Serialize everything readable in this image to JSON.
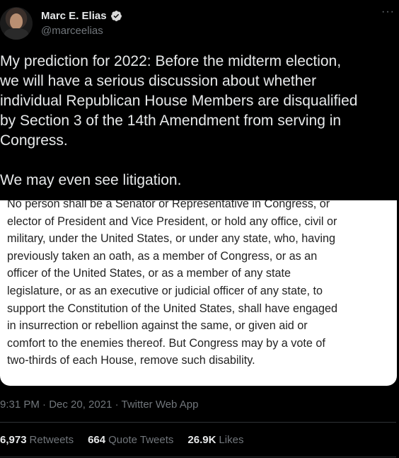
{
  "author": {
    "display_name": "Marc E. Elias",
    "handle": "@marceelias",
    "verified": true,
    "avatar_icon": "profile-photo",
    "more_icon": "more-options-icon"
  },
  "tweet": {
    "text": "My prediction for 2022: Before the midterm election,\nwe will have a serious discussion about whether\nindividual Republican House Members are disqualified\nby Section 3 of the 14th Amendment from serving in\nCongress.\n\nWe may even see litigation."
  },
  "media": {
    "text": "No person shall be a Senator or Representative in Congress, or\nelector of President and Vice President, or hold any office, civil or\nmilitary, under the United States, or under any state, who, having\npreviously taken an oath, as a member of Congress, or as an\nofficer of the United States, or as a member of any state\nlegislature, or as an executive or judicial officer of any state, to\nsupport the Constitution of the United States, shall have engaged\nin insurrection or rebellion against the same, or given aid or\ncomfort to the enemies thereof. But Congress may by a vote of\ntwo-thirds of each House, remove such disability."
  },
  "meta": {
    "timestamp": "9:31 PM · Dec 20, 2021 · Twitter Web App"
  },
  "stats": {
    "retweets": {
      "count": "6,973",
      "label": "Retweets"
    },
    "quote_tweets": {
      "count": "664",
      "label": "Quote Tweets"
    },
    "likes": {
      "count": "26.9K",
      "label": "Likes"
    }
  },
  "colors": {
    "background": "#000000",
    "text": "#e7e9ea",
    "secondary": "#71767b",
    "verified": "#1d9bf0"
  }
}
